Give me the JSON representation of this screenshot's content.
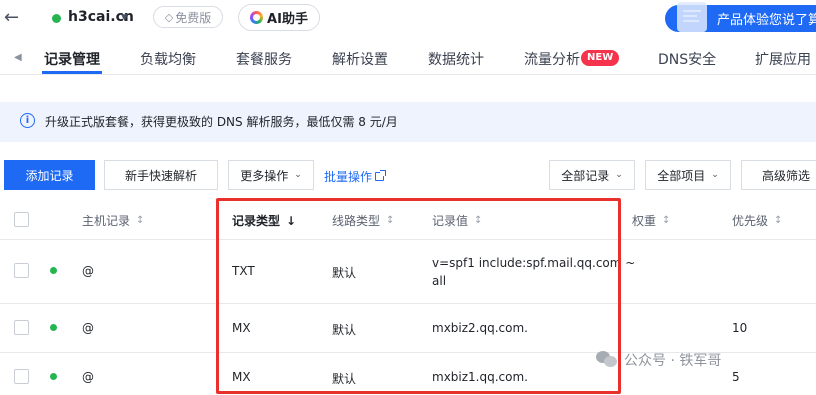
{
  "header": {
    "domain": "h3cai.cn",
    "free_badge": "免费版",
    "ai_button": "AI助手",
    "feedback": "产品体验您说了算"
  },
  "tabs": [
    {
      "label": "记录管理",
      "active": true
    },
    {
      "label": "负载均衡"
    },
    {
      "label": "套餐服务"
    },
    {
      "label": "解析设置"
    },
    {
      "label": "数据统计"
    },
    {
      "label": "流量分析"
    },
    {
      "label": "DNS安全"
    },
    {
      "label": "扩展应用"
    }
  ],
  "new_badge": "NEW",
  "notice": {
    "icon": "i",
    "text": "升级正式版套餐，获得更极致的 DNS 解析服务，最低仅需 8 元/月"
  },
  "toolbar": {
    "add_record": "添加记录",
    "quick_resolve": "新手快速解析",
    "more_actions": "更多操作",
    "batch_actions": "批量操作",
    "all_records": "全部记录",
    "all_items": "全部项目",
    "advanced_filter": "高级筛选"
  },
  "table": {
    "columns": {
      "host": "主机记录",
      "type": "记录类型",
      "line": "线路类型",
      "value": "记录值",
      "weight": "权重",
      "priority": "优先级"
    },
    "rows": [
      {
        "host": "@",
        "type": "TXT",
        "line": "默认",
        "value_line1": "v=spf1 include:spf.mail.qq.com ~",
        "value_line2": "all",
        "priority": ""
      },
      {
        "host": "@",
        "type": "MX",
        "line": "默认",
        "value_line1": "mxbiz2.qq.com.",
        "value_line2": "",
        "priority": "10"
      },
      {
        "host": "@",
        "type": "MX",
        "line": "默认",
        "value_line1": "mxbiz1.qq.com.",
        "value_line2": "",
        "priority": "5"
      }
    ]
  },
  "watermark": "公众号 · 铁军哥",
  "colors": {
    "accent": "#1e6af5",
    "status_green": "#27b552",
    "highlight_red": "#e8312d",
    "new_badge": "#f5334c"
  }
}
